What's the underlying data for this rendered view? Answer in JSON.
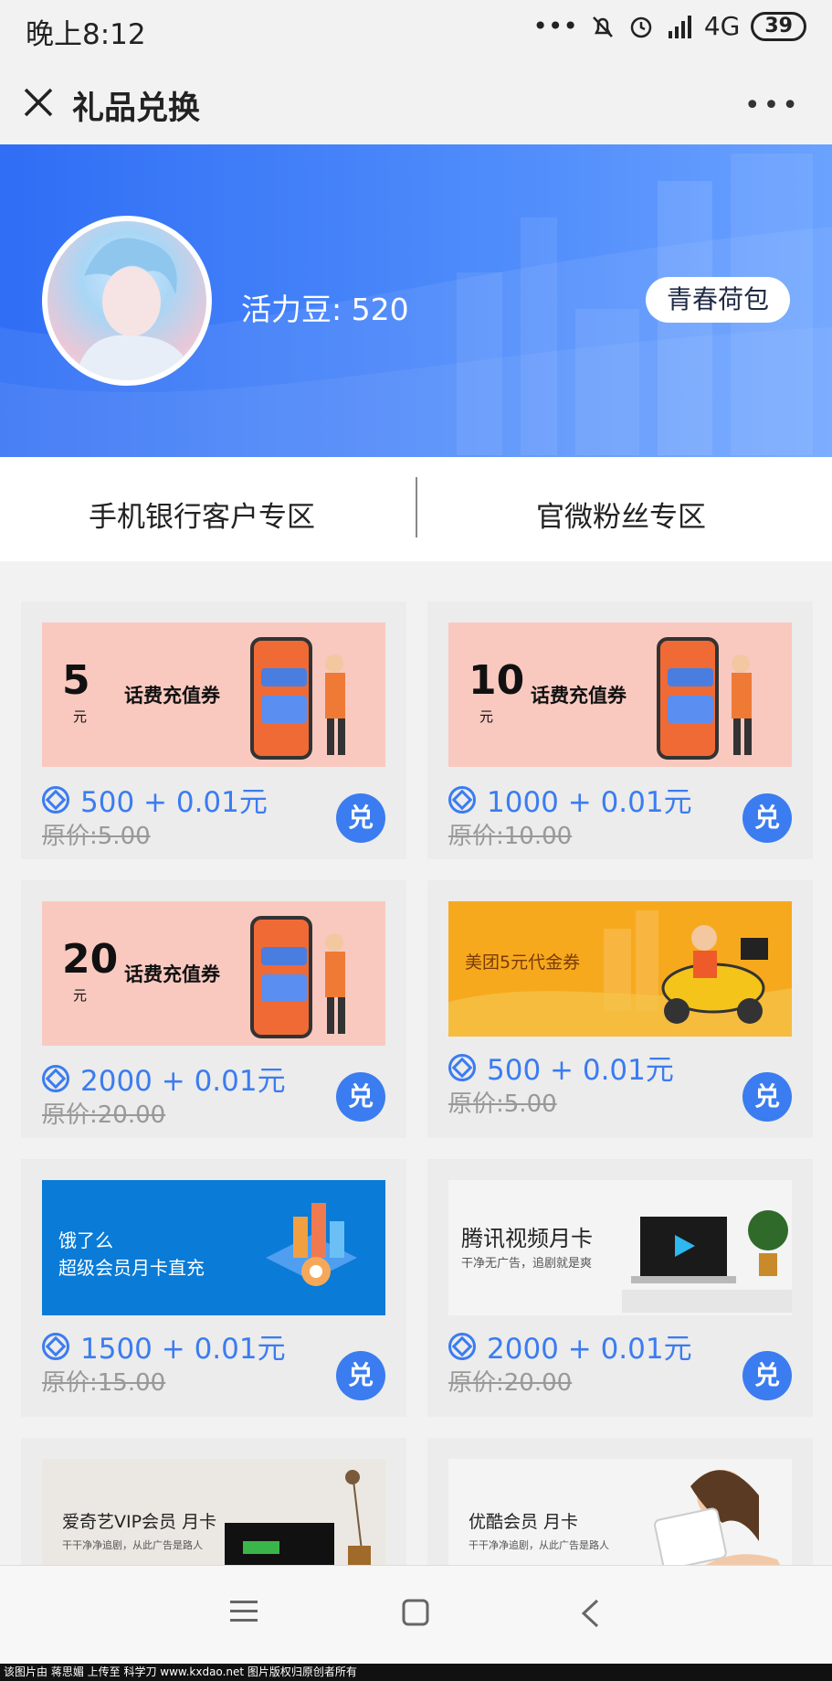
{
  "status_bar": {
    "time": "晚上8:12",
    "network": "4G",
    "battery": "39"
  },
  "title_bar": {
    "title": "礼品兑换"
  },
  "profile": {
    "points_label": "活力豆: 520",
    "wallet_button": "青春荷包"
  },
  "tabs": [
    {
      "label": "手机银行客户专区"
    },
    {
      "label": "官微粉丝专区"
    }
  ],
  "products": [
    {
      "image_big": "5",
      "image_unit": "元",
      "image_text": "话费充值券",
      "price": "500 + 0.01元",
      "original": "原价:5.00",
      "redeem": "兑"
    },
    {
      "image_big": "10",
      "image_unit": "元",
      "image_text": "话费充值券",
      "price": "1000 + 0.01元",
      "original": "原价:10.00",
      "redeem": "兑"
    },
    {
      "image_big": "20",
      "image_unit": "元",
      "image_text": "话费充值券",
      "price": "2000 + 0.01元",
      "original": "原价:20.00",
      "redeem": "兑"
    },
    {
      "image_text": "美团5元代金券",
      "price": "500 + 0.01元",
      "original": "原价:5.00",
      "redeem": "兑"
    },
    {
      "image_line1": "饿了么",
      "image_line2": "超级会员月卡直充",
      "price": "1500 + 0.01元",
      "original": "原价:15.00",
      "redeem": "兑"
    },
    {
      "image_line1": "腾讯视频月卡",
      "image_line2": "干净无广告，追剧就是爽",
      "price": "2000 + 0.01元",
      "original": "原价:20.00",
      "redeem": "兑"
    },
    {
      "image_line1": "爱奇艺VIP会员  月卡",
      "image_line2": "干干净净追剧，从此广告是路人"
    },
    {
      "image_line1": "优酷会员  月卡",
      "image_line2": "干干净净追剧，从此广告是路人"
    }
  ],
  "footer": {
    "credit": "该图片由 蒋思媚 上传至 科学刀 www.kxdao.net 图片版权归原创者所有"
  }
}
